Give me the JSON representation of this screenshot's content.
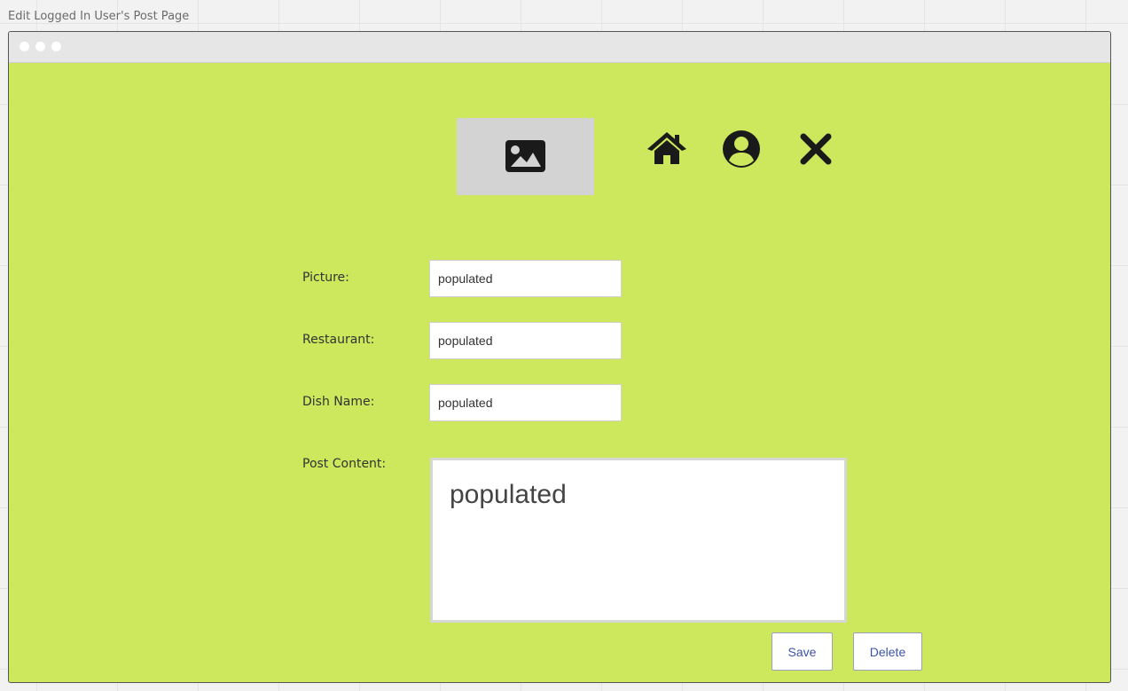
{
  "board": {
    "title": "Edit Logged In User's Post Page"
  },
  "header": {
    "image_icon": "image-icon",
    "nav": [
      {
        "name": "home",
        "icon": "home-icon"
      },
      {
        "name": "profile",
        "icon": "user-circle-icon"
      },
      {
        "name": "close",
        "icon": "close-icon"
      }
    ]
  },
  "form": {
    "picture": {
      "label": "Picture:",
      "value": "populated"
    },
    "restaurant": {
      "label": "Restaurant:",
      "value": "populated"
    },
    "dish_name": {
      "label": "Dish Name:",
      "value": "populated"
    },
    "post_content": {
      "label": "Post Content:",
      "value": "populated"
    }
  },
  "actions": {
    "save_label": "Save",
    "delete_label": "Delete"
  },
  "colors": {
    "page_background": "#cde85c",
    "placeholder": "#d3d3d3",
    "icon": "#1a1a1a",
    "button_text": "#3d54a8"
  }
}
